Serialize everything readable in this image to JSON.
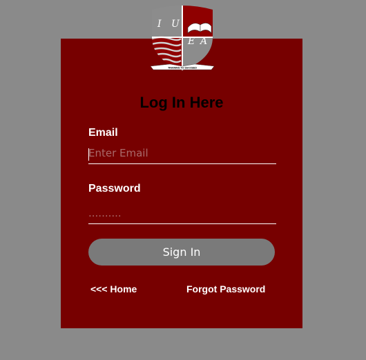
{
  "form": {
    "title": "Log In Here",
    "email_label": "Email",
    "email_placeholder": "Enter Email",
    "email_value": "",
    "password_label": "Password",
    "password_placeholder": "..........",
    "password_value": "",
    "sign_in_label": "Sign In",
    "home_link": "<<< Home",
    "forgot_link": "Forgot Password"
  },
  "logo": {
    "letters": [
      "I",
      "U",
      "E",
      "A"
    ],
    "motto": "TRAINING TO SUCCEED",
    "icon": "book-icon"
  },
  "colors": {
    "page_background": "#8a8a8a",
    "card_background": "#770000",
    "button_background": "#7a7a7a",
    "text": "#ffffff",
    "title": "#000000"
  }
}
